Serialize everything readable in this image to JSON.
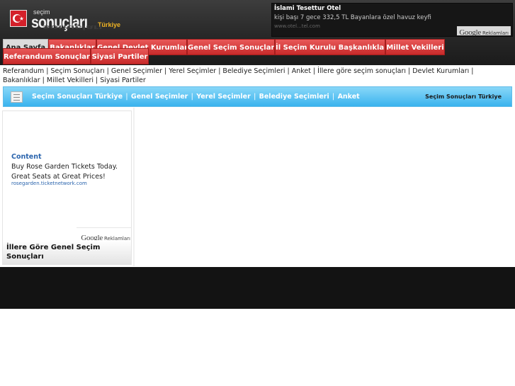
{
  "logo": {
    "sub": "seçim",
    "main": "sonuçları",
    "country": "Türkiye",
    "flag_icon": "turkey-flag-icon"
  },
  "top_ad": {
    "title": "İslami Tesettur Otel",
    "text": "kişi başı 7 gece 332,5 TL Bayanlara özel havuz keyfi",
    "url": "www.otel...tel.com",
    "google": "Google",
    "label": "Reklamları"
  },
  "nav": {
    "items": [
      {
        "label": "Ana Sayfa"
      },
      {
        "label": "Bakanlıklar"
      },
      {
        "label": "Genel Devlet Kurumları"
      },
      {
        "label": "Genel Seçim Sonuçları"
      },
      {
        "label": "İl Seçim Kurulu Başkanlıkları"
      },
      {
        "label": "Millet Vekilleri"
      },
      {
        "label": "Referandum Sonuçları"
      },
      {
        "label": "Siyasi Partiler"
      }
    ]
  },
  "breadcrumb": {
    "text": "Referandum | Seçim Sonuçları | Genel Seçimler | Yerel Seçimler | Belediye Seçimleri | Anket | İllere göre seçim sonuçları | Devlet Kurumları | Bakanlıklar | Millet Vekilleri | Siyasi Partiler"
  },
  "subbar": {
    "links": [
      {
        "label": "Seçim Sonuçları Türkiye"
      },
      {
        "label": "Genel Seçimler"
      },
      {
        "label": "Yerel Seçimler"
      },
      {
        "label": "Belediye Seçimleri"
      },
      {
        "label": "Anket"
      }
    ],
    "separator": "|",
    "right": "Seçim Sonuçları Türkiye"
  },
  "side_ad": {
    "title": "Content",
    "text": "Buy Rose Garden Tickets Today. Great Seats at Great Prices!",
    "url": "rosegarden.ticketnetwork.com",
    "google": "Google",
    "label": "Reklamları"
  },
  "side_box": {
    "title": "İllere Göre Genel Seçim Sonuçları"
  },
  "colors": {
    "nav_red": "#d63a3a",
    "subbar_blue": "#3ab3ee",
    "link_blue": "#2a64ad",
    "header_dark": "#262626"
  }
}
